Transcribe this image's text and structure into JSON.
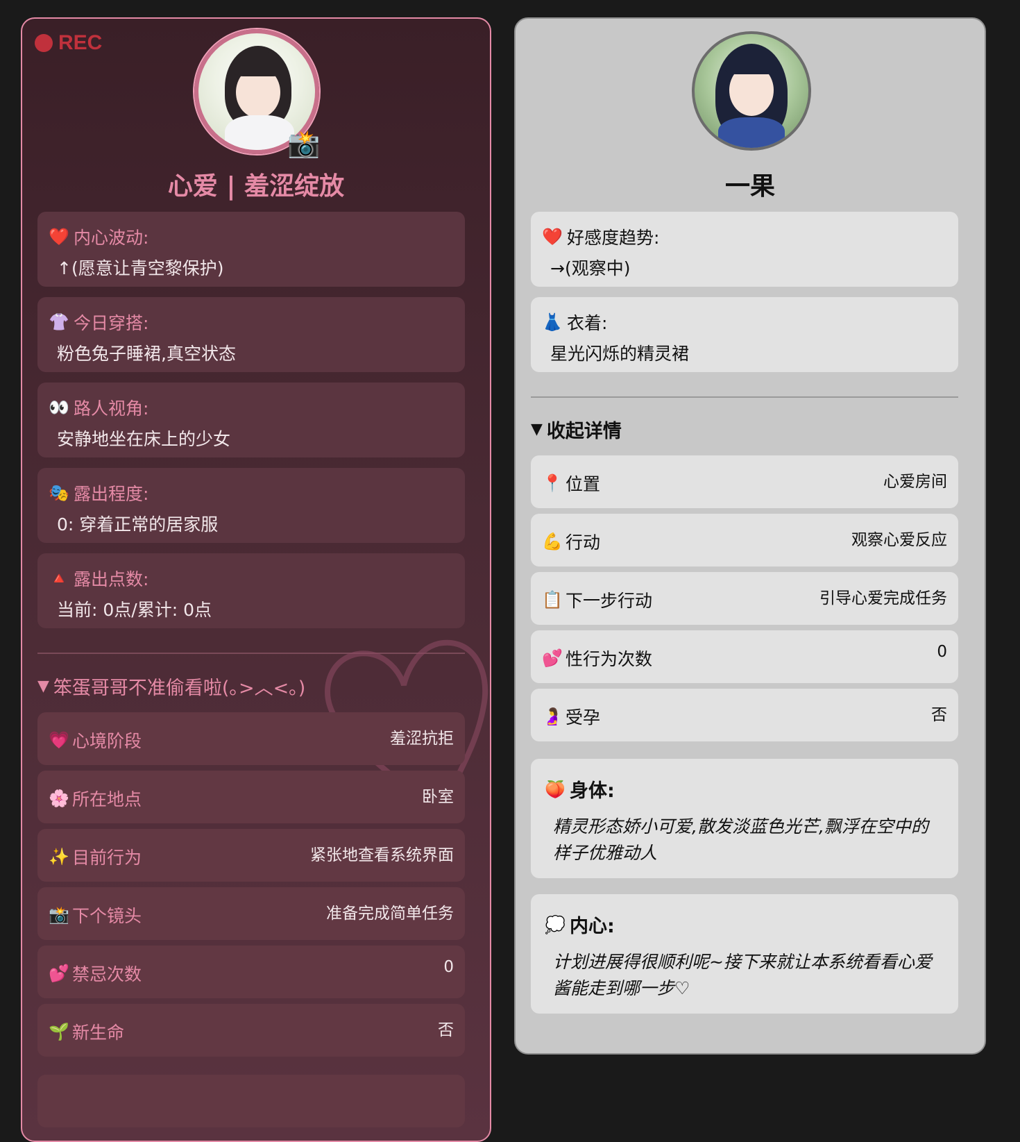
{
  "left": {
    "rec_label": "REC",
    "camera_badge": "📸",
    "name": "心爱 | 羞涩绽放",
    "cards": [
      {
        "icon": "❤️",
        "label": "内心波动:",
        "value": "↑(愿意让青空黎保护)"
      },
      {
        "icon": "👚",
        "label": "今日穿搭:",
        "value": "粉色兔子睡裙,真空状态"
      },
      {
        "icon": "👀",
        "label": "路人视角:",
        "value": "安静地坐在床上的少女"
      },
      {
        "icon": "🎭",
        "label": "露出程度:",
        "value": "0: 穿着正常的居家服"
      },
      {
        "icon": "🔺",
        "label": "露出点数:",
        "value": "当前: 0点/累计: 0点"
      }
    ],
    "summary_marker": "▼",
    "summary": "笨蛋哥哥不准偷看啦(｡>︿<｡)",
    "rows": [
      {
        "icon": "💗",
        "label": "心境阶段",
        "value": "羞涩抗拒"
      },
      {
        "icon": "🌸",
        "label": "所在地点",
        "value": "卧室"
      },
      {
        "icon": "✨",
        "label": "目前行为",
        "value": "紧张地查看系统界面"
      },
      {
        "icon": "📸",
        "label": "下个镜头",
        "value": "准备完成简单任务"
      },
      {
        "icon": "💕",
        "label": "禁忌次数",
        "value": "0"
      },
      {
        "icon": "🌱",
        "label": "新生命",
        "value": "否"
      }
    ]
  },
  "right": {
    "name": "一果",
    "cards": [
      {
        "icon": "❤️",
        "label": "好感度趋势:",
        "value": "→(观察中)"
      },
      {
        "icon": "👗",
        "label": "衣着:",
        "value": "星光闪烁的精灵裙"
      }
    ],
    "summary_marker": "▼",
    "summary": "收起详情",
    "rows": [
      {
        "icon": "📍",
        "label": "位置",
        "value": "心爱房间"
      },
      {
        "icon": "💪",
        "label": "行动",
        "value": "观察心爱反应"
      },
      {
        "icon": "📋",
        "label": "下一步行动",
        "value": "引导心爱完成任务"
      },
      {
        "icon": "💕",
        "label": "性行为次数",
        "value": "0"
      },
      {
        "icon": "🤰",
        "label": "受孕",
        "value": "否"
      }
    ],
    "body": {
      "icon": "🍑",
      "title": "身体:",
      "text": "精灵形态娇小可爱,散发淡蓝色光芒,飘浮在空中的样子优雅动人"
    },
    "inner": {
      "icon": "💭",
      "title": "内心:",
      "text": "计划进展得很顺利呢~接下来就让本系统看看心爱酱能走到哪一步♡"
    }
  },
  "colors": {
    "page_bg": "#1a1a1a",
    "left_panel_bg": "#3a1f27",
    "left_accent": "#e58aa6",
    "rec_red": "#c0313c",
    "right_panel_bg": "#c8c8c8",
    "right_card_bg": "#e2e2e2"
  }
}
